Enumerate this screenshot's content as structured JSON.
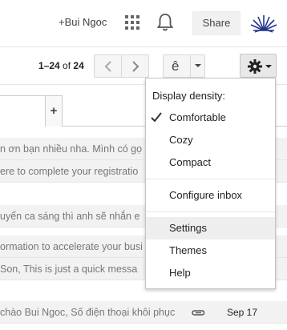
{
  "header": {
    "user_link": "+Bui Ngoc",
    "share_label": "Share"
  },
  "toolbar": {
    "range": "1–24",
    "of_label": "of",
    "total": "24",
    "input_tool_glyph": "ê"
  },
  "tabs": {
    "add_label": "+"
  },
  "messages": [
    {
      "snippet": "n ơn bạn nhiều nha. Mình có gọ"
    },
    {
      "snippet": "ere to complete your registratio"
    },
    {
      "snippet": "uyển ca sáng thì anh sẽ nhắn e"
    },
    {
      "snippet": "ormation to accelerate your busi"
    },
    {
      "snippet": "Son, This is just a quick messa"
    },
    {
      "snippet": "chào Bui Ngoc, Số điện thoại khôi phục",
      "has_attachment": true,
      "date": "Sep 17"
    }
  ],
  "settings_menu": {
    "heading": "Display density:",
    "density_options": [
      {
        "label": "Comfortable",
        "checked": true
      },
      {
        "label": "Cozy",
        "checked": false
      },
      {
        "label": "Compact",
        "checked": false
      }
    ],
    "configure_inbox": "Configure inbox",
    "settings": "Settings",
    "themes": "Themes",
    "help": "Help"
  },
  "icons": {
    "apps": "apps-grid-icon",
    "notifications": "bell-icon",
    "logo": "lotus-logo-icon",
    "prev": "chevron-left-icon",
    "next": "chevron-right-icon",
    "settings": "gear-icon",
    "attachment": "paperclip-icon",
    "check": "checkmark-icon"
  }
}
